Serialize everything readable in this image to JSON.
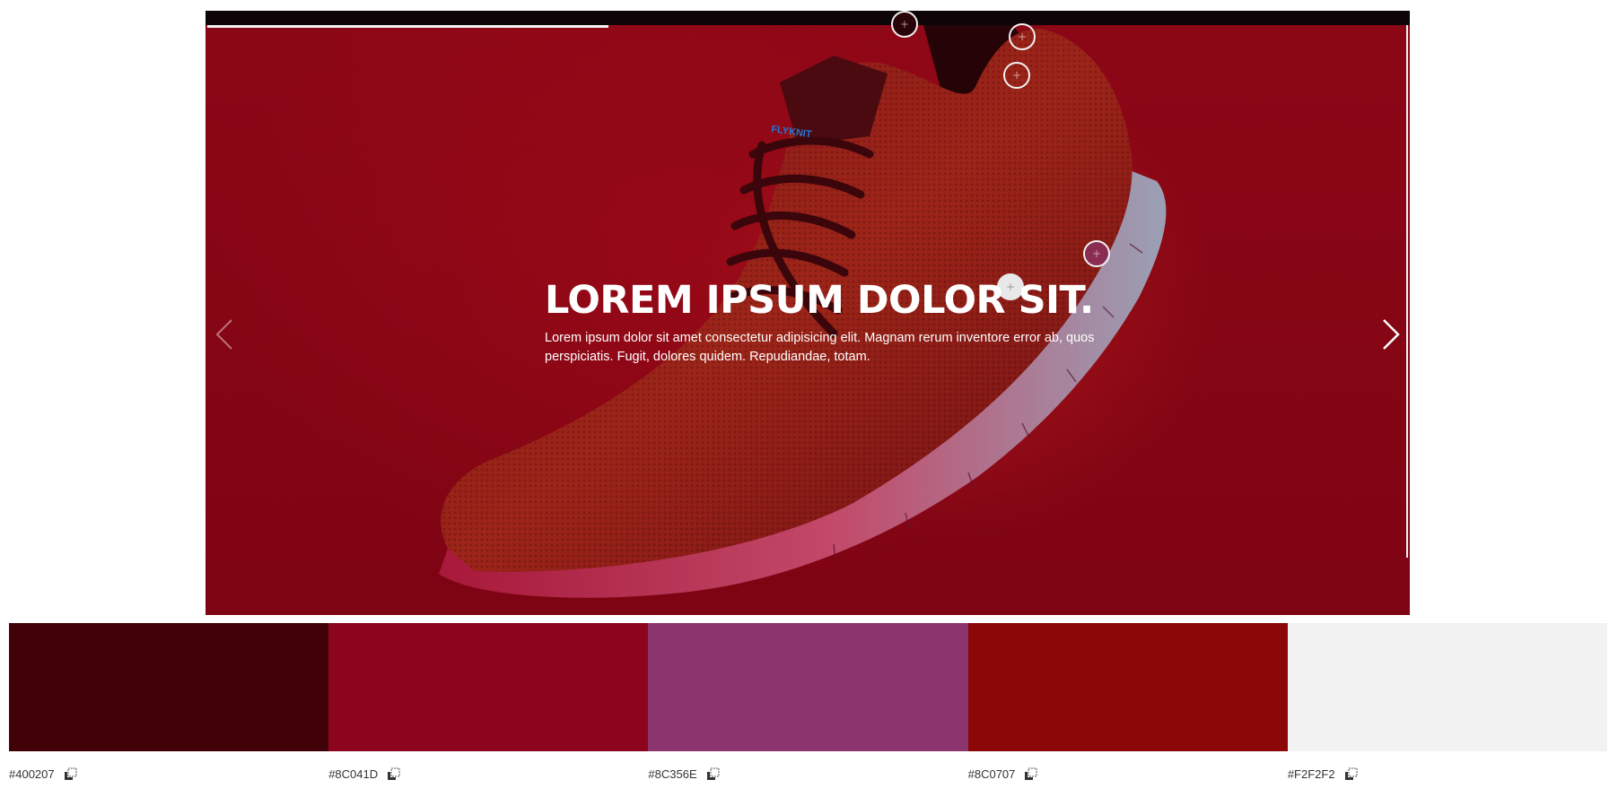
{
  "slider": {
    "progress_fraction": 0.334,
    "title": "LOREM IPSUM DOLOR SIT.",
    "description": "Lorem ipsum dolor sit amet consectetur adipisicing elit. Magnam rerum inventore error ab, quos perspiciatis. Fugit, dolores quidem. Repudiandae, totam.",
    "prev_icon": "chevron-left-icon",
    "next_icon": "chevron-right-icon",
    "hotspot_icon": "plus-icon",
    "shoe_brand_text": "FLYKNIT"
  },
  "palette": {
    "colors": [
      {
        "hex": "#400207",
        "label": "#400207"
      },
      {
        "hex": "#8C041D",
        "label": "#8C041D"
      },
      {
        "hex": "#8C356E",
        "label": "#8C356E"
      },
      {
        "hex": "#8C0707",
        "label": "#8C0707"
      },
      {
        "hex": "#F2F2F2",
        "label": "#F2F2F2"
      }
    ],
    "copy_icon": "copy-icon"
  }
}
